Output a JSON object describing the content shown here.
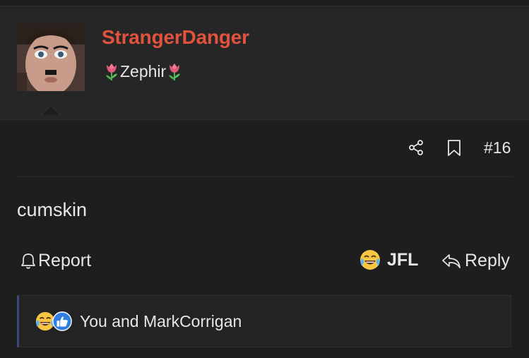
{
  "user": {
    "username": "StrangerDanger",
    "title": "Zephir",
    "title_emoji": "tulip-icon"
  },
  "post": {
    "number": "#16",
    "message": "cumskin"
  },
  "actions": {
    "report_label": "Report",
    "reaction_label": "JFL",
    "reply_label": "Reply"
  },
  "reactions": {
    "summary": "You and MarkCorrigan",
    "icons": [
      "laughing-crying-icon",
      "thumbs-up-icon"
    ]
  },
  "colors": {
    "username": "#e2533d",
    "background": "#1e1e1e",
    "header_background": "#262626",
    "reaction_accent": "#3a4a7a"
  }
}
